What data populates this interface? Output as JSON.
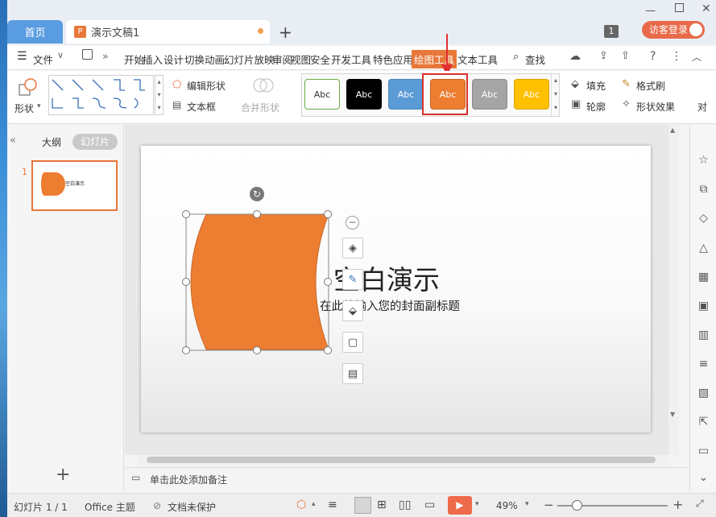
{
  "tabs": {
    "home": "首页",
    "doc": "演示文稿1",
    "new_tab": "+",
    "badge": "1",
    "login": "访客登录"
  },
  "menu": {
    "file": "文件",
    "items": [
      "开始",
      "插入",
      "设计",
      "切换",
      "动画",
      "幻灯片放映",
      "审阅",
      "视图",
      "安全",
      "开发工具",
      "特色应用",
      "绘图工具",
      "文本工具"
    ],
    "search": "查找"
  },
  "ribbon": {
    "shape": "形状",
    "edit_shape": "编辑形状",
    "text_box": "文本框",
    "merge_shape": "合并形状",
    "styles": [
      {
        "label": "Abc",
        "bg": "#ffffff",
        "fg": "#333333",
        "border": "#6aaa4a"
      },
      {
        "label": "Abc",
        "bg": "#000000",
        "fg": "#ffffff",
        "border": "#000000"
      },
      {
        "label": "Abc",
        "bg": "#5b9bd5",
        "fg": "#ffffff",
        "border": "#4a86be"
      },
      {
        "label": "Abc",
        "bg": "#ed7d31",
        "fg": "#ffffff",
        "border": "#c96520"
      },
      {
        "label": "Abc",
        "bg": "#a5a5a5",
        "fg": "#ffffff",
        "border": "#8c8c8c"
      },
      {
        "label": "Abc",
        "bg": "#ffc000",
        "fg": "#ffffff",
        "border": "#d9a300"
      }
    ],
    "fill": "填充",
    "format_brush": "格式刷",
    "outline": "轮廓",
    "shape_effect": "形状效果",
    "cut_char": "对"
  },
  "panel": {
    "outline_tab": "大纲",
    "slides_tab": "幻灯片",
    "slide_number": "1",
    "thumb_title": "空白演示"
  },
  "slide": {
    "title": "空白演示",
    "subtitle": "在此处输入您的封面副标题",
    "shape_color": "#ed7d31"
  },
  "notes": {
    "placeholder": "单击此处添加备注"
  },
  "status": {
    "slide_count": "幻灯片 1 / 1",
    "theme": "Office 主题",
    "protect": "文档未保护",
    "zoom": "49%"
  },
  "colors": {
    "accent": "#e8773a",
    "highlight_border": "#d9302a",
    "tab_blue": "#5a9ce0"
  }
}
